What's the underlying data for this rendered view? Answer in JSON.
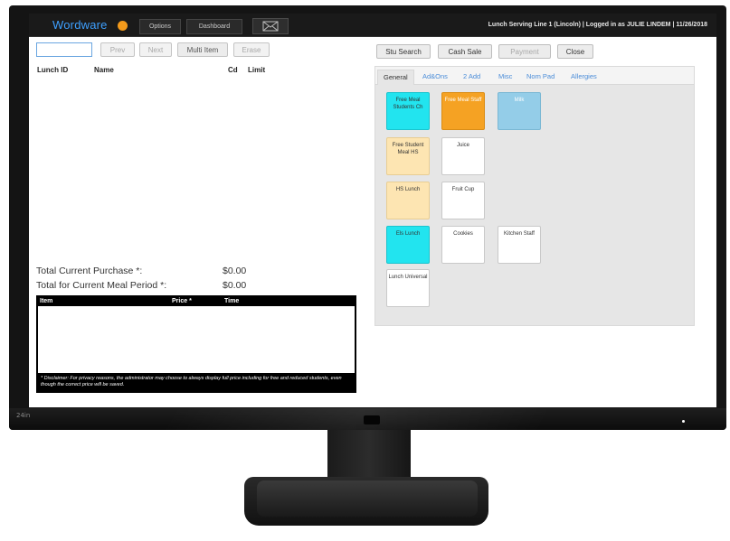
{
  "header": {
    "logo": "Wordware",
    "nav": [
      "Options",
      "Dashboard"
    ],
    "user_info": "Lunch Serving Line 1 (Lincoln) | Logged in as JULIE LINDEM | 11/26/2018"
  },
  "toolbar": {
    "prev": "Prev",
    "next": "Next",
    "multi_item": "Multi Item",
    "erase": "Erase"
  },
  "columns": {
    "lunch_id": "Lunch ID",
    "name": "Name",
    "cd": "Cd",
    "limit": "Limit"
  },
  "totals": {
    "current_purchase_label": "Total  Current Purchase *:",
    "current_purchase_value": "$0.00",
    "meal_period_label": "Total  for Current Meal Period *:",
    "meal_period_value": "$0.00"
  },
  "items_table": {
    "headers": [
      "Item",
      "Price *",
      "Time"
    ],
    "disclaimer": "* Disclaimer: For privacy reasons, the administrator may choose to always display full price including for free and reduced students, even though the correct price will be saved."
  },
  "actions": {
    "stu_search": "Stu Search",
    "cash_sale": "Cash Sale",
    "payment": "Payment",
    "close": "Close"
  },
  "tabs": [
    "General",
    "Ad&Ons",
    "2 Add",
    "Misc",
    "Nom Pad",
    "Allergies"
  ],
  "tiles": [
    {
      "label": "Free Meal Students Ch",
      "color": "#22e4ef"
    },
    {
      "label": "Free Meal Staff",
      "color": "#f5a223"
    },
    {
      "label": "Milk",
      "color": "#94cde8"
    },
    {
      "label": "Free Student Meal HS",
      "color": "#fde5b2"
    },
    {
      "label": "Juice",
      "color": "#ffffff"
    },
    {
      "label": "HS Lunch",
      "color": "#fde5b2"
    },
    {
      "label": "Fruit Cup",
      "color": "#ffffff"
    },
    {
      "label": "Els Lunch",
      "color": "#22e4ef"
    },
    {
      "label": "Cookies",
      "color": "#ffffff"
    },
    {
      "label": "Kitchen Staff",
      "color": "#ffffff"
    },
    {
      "label": "Lunch Universal",
      "color": "#ffffff"
    }
  ],
  "bezel_label": "24in"
}
